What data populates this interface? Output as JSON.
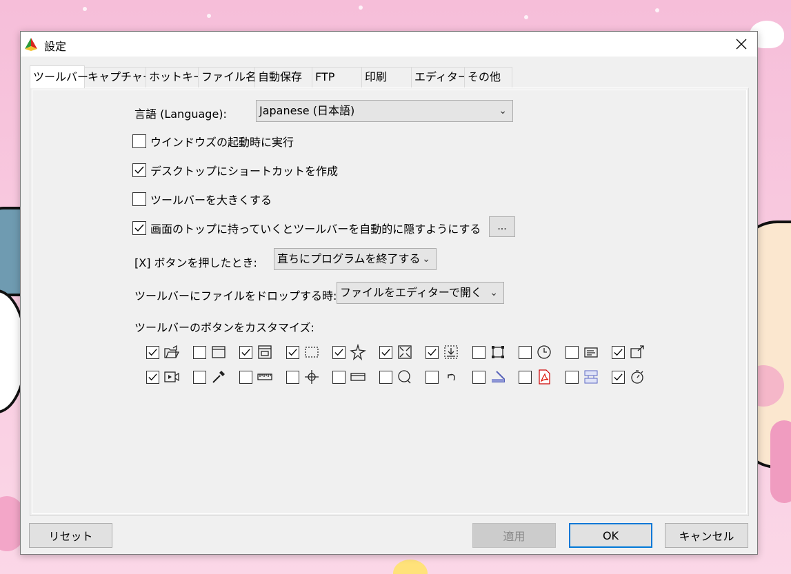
{
  "window": {
    "title": "設定"
  },
  "tabs": [
    {
      "label": "ツールバー",
      "active": true
    },
    {
      "label": "キャプチャー"
    },
    {
      "label": "ホットキー"
    },
    {
      "label": "ファイル名"
    },
    {
      "label": "自動保存"
    },
    {
      "label": "FTP"
    },
    {
      "label": "印刷"
    },
    {
      "label": "エディター"
    },
    {
      "label": "その他"
    }
  ],
  "language": {
    "label": "言語 (Language):",
    "value": "Japanese (日本語)"
  },
  "options": [
    {
      "label": "ウインドウズの起動時に実行",
      "checked": false
    },
    {
      "label": "デスクトップにショートカットを作成",
      "checked": true
    },
    {
      "label": "ツールバーを大きくする",
      "checked": false
    },
    {
      "label": "画面のトップに持っていくとツールバーを自動的に隠すようにする",
      "checked": true
    }
  ],
  "ellipsis_button": "...",
  "close_action": {
    "label": "[X] ボタンを押したとき:",
    "value": "直ちにプログラムを終了する"
  },
  "drop_action": {
    "label": "ツールバーにファイルをドロップする時:",
    "value": "ファイルをエディターで開く"
  },
  "customize": {
    "label": "ツールバーのボタンをカスタマイズ:",
    "row1": [
      {
        "icon": "open-folder-icon",
        "checked": true
      },
      {
        "icon": "window-icon",
        "checked": false
      },
      {
        "icon": "scrolling-window-icon",
        "checked": true
      },
      {
        "icon": "region-icon",
        "checked": true
      },
      {
        "icon": "freehand-region-icon",
        "checked": true
      },
      {
        "icon": "fullscreen-icon",
        "checked": true
      },
      {
        "icon": "scrolling-capture-icon",
        "checked": true
      },
      {
        "icon": "fixed-region-icon",
        "checked": false
      },
      {
        "icon": "timer-icon",
        "checked": false
      },
      {
        "icon": "text-capture-icon",
        "checked": false
      },
      {
        "icon": "export-icon",
        "checked": true
      }
    ],
    "row2": [
      {
        "icon": "video-icon",
        "checked": true
      },
      {
        "icon": "color-picker-icon",
        "checked": false
      },
      {
        "icon": "ruler-icon",
        "checked": false
      },
      {
        "icon": "crosshair-icon",
        "checked": false
      },
      {
        "icon": "whiteboard-icon",
        "checked": false
      },
      {
        "icon": "magnifier-icon",
        "checked": false
      },
      {
        "icon": "undo-icon",
        "checked": false
      },
      {
        "icon": "scanner-icon",
        "checked": false
      },
      {
        "icon": "pdf-icon",
        "checked": false
      },
      {
        "icon": "combine-icon",
        "checked": false
      },
      {
        "icon": "stopwatch-icon",
        "checked": true
      }
    ]
  },
  "buttons": {
    "reset": "リセット",
    "apply": "適用",
    "ok": "OK",
    "cancel": "キャンセル"
  }
}
